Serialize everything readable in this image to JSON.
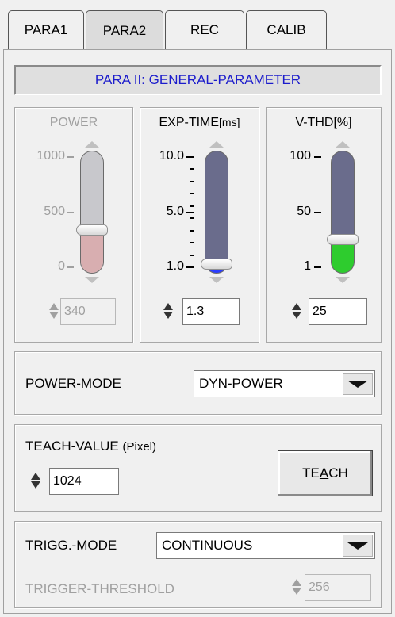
{
  "tabs": [
    {
      "label": "PARA1",
      "active": false
    },
    {
      "label": "PARA2",
      "active": true
    },
    {
      "label": "REC",
      "active": false
    },
    {
      "label": "CALIB",
      "active": false
    }
  ],
  "header": {
    "title": "PARA II: GENERAL-PARAMETER",
    "color": "#1c1ccc"
  },
  "power": {
    "title": "POWER",
    "ticks": [
      "1000",
      "500",
      "0"
    ],
    "value": "340",
    "level_fraction": 0.34,
    "fill_color": "#d8aeb0",
    "enabled": false
  },
  "exp_time": {
    "title": "EXP-TIME",
    "unit": "[ms]",
    "ticks": [
      "10.0",
      "5.0",
      "1.0"
    ],
    "value": "1.3",
    "level_fraction": 0.03,
    "fill_color": "#2a3cff"
  },
  "v_thd": {
    "title": "V-THD[%]",
    "ticks": [
      "100",
      "50",
      "1"
    ],
    "value": "25",
    "level_fraction": 0.25,
    "fill_color": "#2ecc2e"
  },
  "power_mode": {
    "label": "POWER-MODE",
    "selected": "DYN-POWER"
  },
  "teach": {
    "label_main": "TEACH-VALUE",
    "label_unit": "(Pixel)",
    "value": "1024",
    "button_pre": "TE",
    "button_acc": "A",
    "button_post": "CH"
  },
  "trigger": {
    "mode_label": "TRIGG.-MODE",
    "mode_selected": "CONTINUOUS",
    "threshold_label": "TRIGGER-THRESHOLD",
    "threshold_value": "256"
  },
  "colors": {
    "slider_track": "#6a6c8c",
    "slider_track_disabled": "#c8c8cc"
  }
}
